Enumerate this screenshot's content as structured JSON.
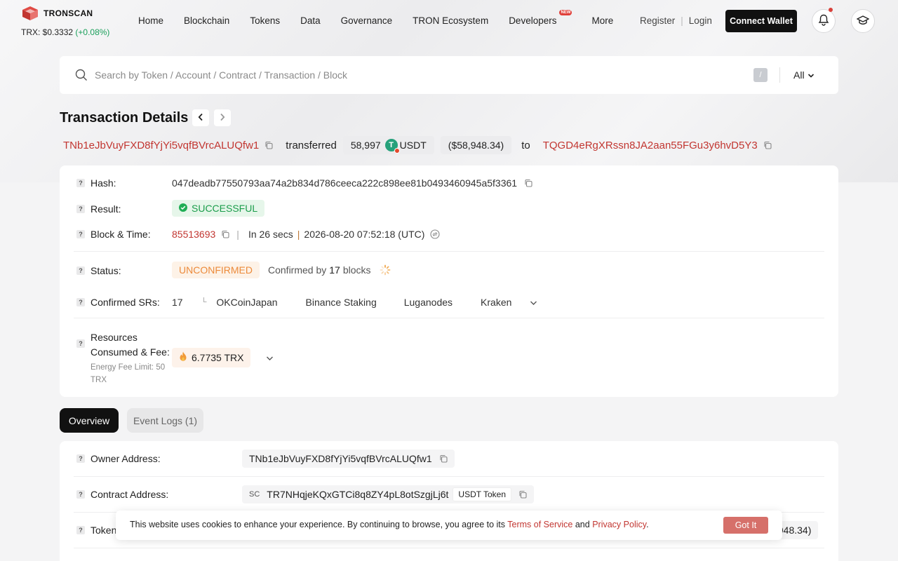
{
  "brand": {
    "name": "TRONSCAN",
    "price_label": "TRX: $0.3332",
    "price_change": "(+0.08%)"
  },
  "nav": {
    "items": [
      "Home",
      "Blockchain",
      "Tokens",
      "Data",
      "Governance",
      "TRON Ecosystem",
      "Developers",
      "More"
    ],
    "developers_badge": "NEW",
    "register": "Register",
    "login": "Login",
    "connect": "Connect Wallet"
  },
  "search": {
    "placeholder": "Search by Token / Account / Contract / Transaction / Block",
    "shortcut": "/",
    "scope": "All"
  },
  "page": {
    "title": "Transaction Details"
  },
  "transfer": {
    "from": "TNb1eJbVuyFXD8fYjYi5vqfBVrcALUQfw1",
    "verb": "transferred",
    "amount": "58,997",
    "token": "USDT",
    "usd": "($58,948.34)",
    "to_word": "to",
    "to": "TQGD4eRgXRssn8JA2aan55FGu3y6hvD5Y3"
  },
  "details": {
    "hash_label": "Hash:",
    "hash": "047deadb77550793aa74a2b834d786ceeca222c898ee81b0493460945a5f3361",
    "result_label": "Result:",
    "result": "SUCCESSFUL",
    "block_label": "Block & Time:",
    "block": "85513693",
    "age": "In 26 secs",
    "time": "2026-08-20 07:52:18 (UTC)",
    "status_label": "Status:",
    "status": "UNCONFIRMED",
    "confirmed_prefix": "Confirmed by",
    "confirmed_count": "17",
    "confirmed_suffix": "blocks",
    "srs_label": "Confirmed SRs:",
    "srs_count": "17",
    "srs": [
      "OKCoinJapan",
      "Binance Staking",
      "Luganodes",
      "Kraken"
    ],
    "resources_label_1": "Resources",
    "resources_label_2": "Consumed & Fee:",
    "energy_limit": "Energy Fee Limit: 50 TRX",
    "fee": "6.7735 TRX"
  },
  "tabs": {
    "overview": "Overview",
    "event_logs": "Event Logs (1)"
  },
  "overview": {
    "owner_label": "Owner Address:",
    "owner": "TNb1eJbVuyFXD8fYjYi5vqfBVrcALUQfw1",
    "contract_label": "Contract Address:",
    "contract_tag": "SC",
    "contract": "TR7NHqjeKQxGTCi8q8ZY4pL8otSzgjLj6t",
    "contract_token": "USDT Token",
    "token_label": "Token",
    "token_value_partial": ",948.34)"
  },
  "cookie": {
    "text": "This website uses cookies to enhance your experience. By continuing to browse, you agree to its",
    "terms": "Terms of Service",
    "and": "and",
    "privacy": "Privacy Policy",
    "end": ".",
    "button": "Got It"
  }
}
